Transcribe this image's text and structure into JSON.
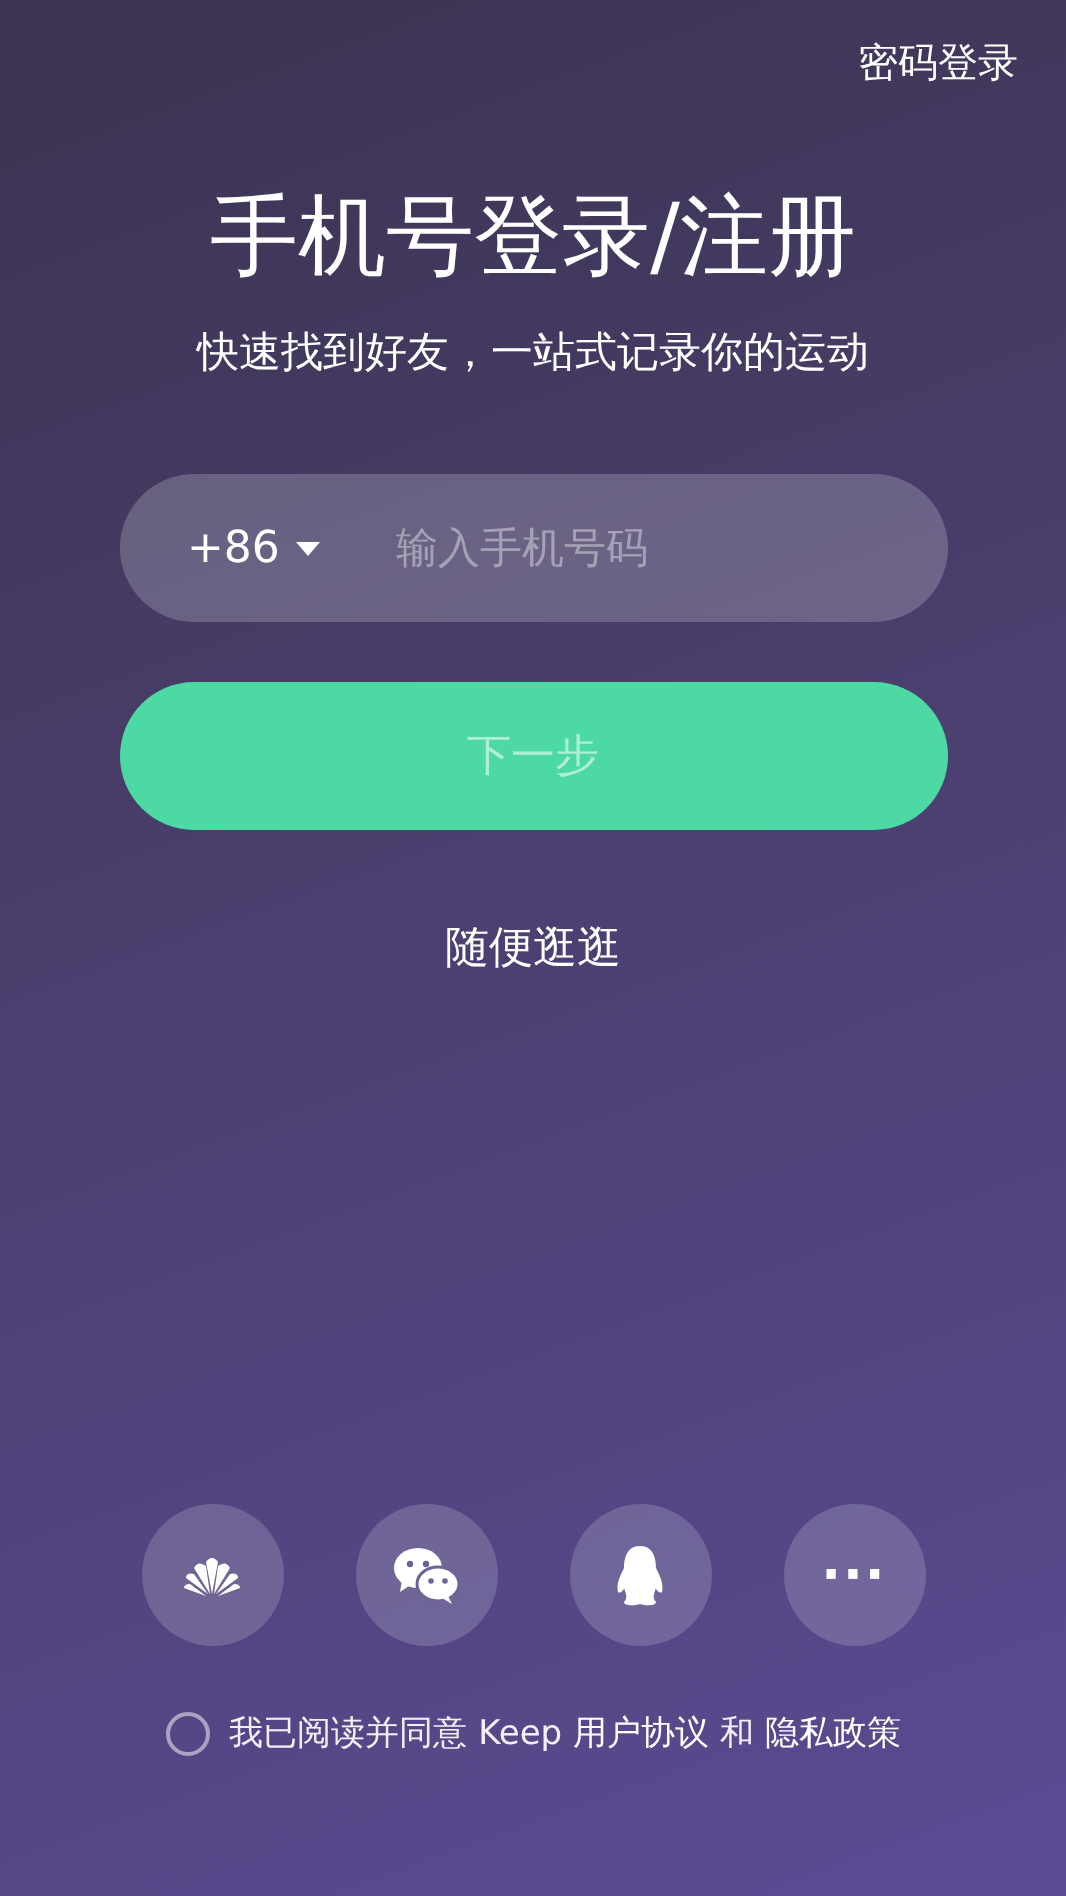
{
  "header": {
    "password_login": "密码登录"
  },
  "title": "手机号登录/注册",
  "subtitle": "快速找到好友，一站式记录你的运动",
  "phone_field": {
    "country_code": "+86",
    "placeholder": "输入手机号码"
  },
  "next_button": {
    "label": "下一步",
    "disabled": true
  },
  "browse_link": "随便逛逛",
  "social_logins": [
    {
      "kind": "flower"
    },
    {
      "kind": "chat"
    },
    {
      "kind": "penguin"
    },
    {
      "kind": "more",
      "glyph": "···"
    }
  ],
  "agreement": {
    "checked": false,
    "text": "我已阅读并同意 Keep",
    "terms_link": "用户协议",
    "joiner": "和",
    "privacy_link": "隐私政策"
  }
}
